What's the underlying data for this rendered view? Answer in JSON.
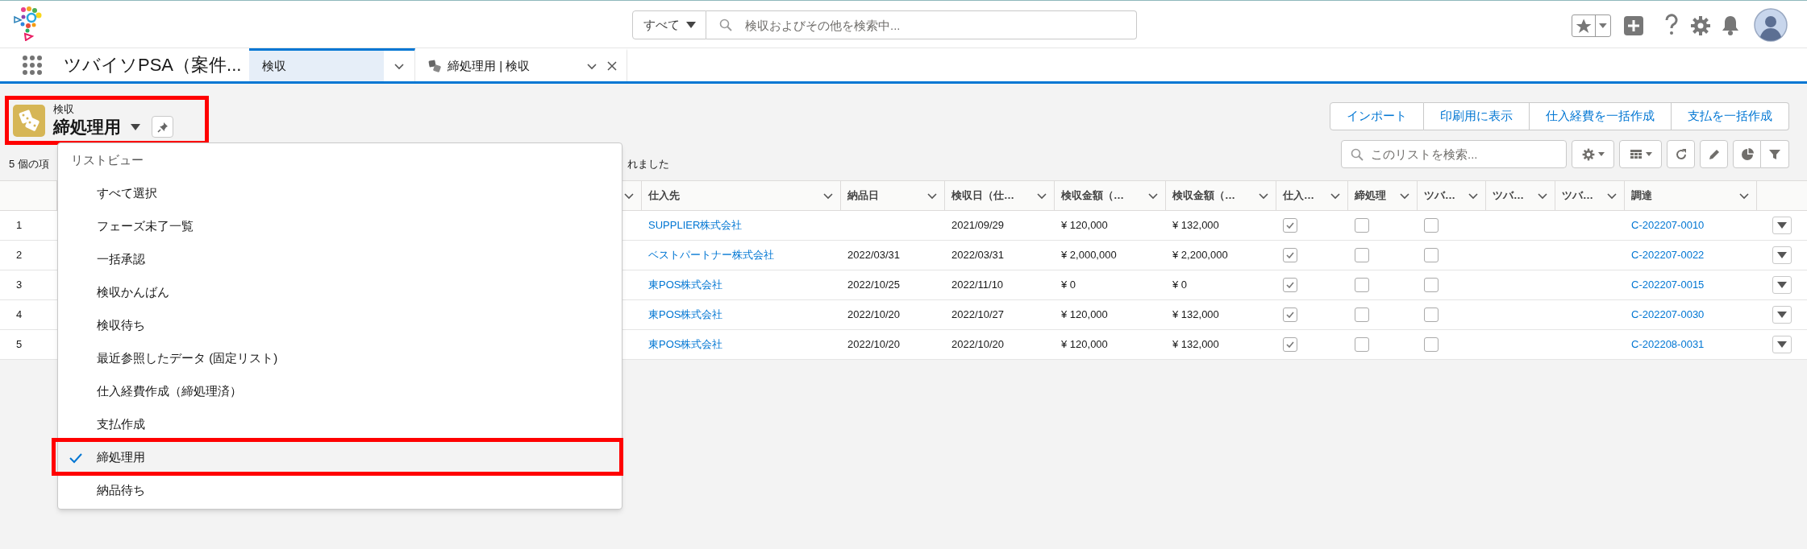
{
  "header": {
    "search_scope": "すべて",
    "search_placeholder": "検収およびその他を検索中..."
  },
  "nav": {
    "app_name": "ツバイソPSA（案件...",
    "tabs": [
      {
        "label": "検収",
        "selected": true,
        "kind": "object",
        "closable": false
      },
      {
        "label": "締処理用 | 検収",
        "selected": false,
        "kind": "list",
        "closable": true
      }
    ]
  },
  "list_header": {
    "object_label": "検収",
    "view_name": "締処理用",
    "status_left": "5 個の項",
    "status_right": "れました",
    "actions": [
      "インポート",
      "印刷用に表示",
      "仕入経費を一括作成",
      "支払を一括作成"
    ],
    "search_placeholder": "このリストを検索..."
  },
  "table": {
    "columns": [
      "仕入先",
      "納品日",
      "検収日（仕…",
      "検収金額（…",
      "検収金額（…",
      "仕入…",
      "締処理",
      "ツバ…",
      "ツバ…",
      "ツバ…",
      "調達"
    ],
    "rows": [
      {
        "number": "1",
        "supplier": "SUPPLIER株式会社",
        "inspection_date": "2021/09/29",
        "amount": "¥ 120,000",
        "amount_tax": "¥ 132,000",
        "purchase_checked": true,
        "closing_checked": false,
        "tsuba_checked": false,
        "procurement": "C-202207-0010"
      },
      {
        "number": "2",
        "supplier": "ベストパートナー株式会社",
        "delivery_date": "2022/03/31",
        "inspection_date": "2022/03/31",
        "amount": "¥ 2,000,000",
        "amount_tax": "¥ 2,200,000",
        "purchase_checked": true,
        "closing_checked": false,
        "tsuba_checked": false,
        "procurement": "C-202207-0022"
      },
      {
        "number": "3",
        "supplier": "東POS株式会社",
        "delivery_date": "2022/10/25",
        "inspection_date": "2022/11/10",
        "amount": "¥ 0",
        "amount_tax": "¥ 0",
        "purchase_checked": true,
        "closing_checked": false,
        "tsuba_checked": false,
        "procurement": "C-202207-0015"
      },
      {
        "number": "4",
        "supplier": "東POS株式会社",
        "delivery_date": "2022/10/20",
        "inspection_date": "2022/10/27",
        "amount": "¥ 120,000",
        "amount_tax": "¥ 132,000",
        "purchase_checked": true,
        "closing_checked": false,
        "tsuba_checked": false,
        "procurement": "C-202207-0030"
      },
      {
        "number": "5",
        "supplier": "東POS株式会社",
        "delivery_date": "2022/10/20",
        "inspection_date": "2022/10/20",
        "amount": "¥ 120,000",
        "amount_tax": "¥ 132,000",
        "purchase_checked": true,
        "closing_checked": false,
        "tsuba_checked": false,
        "procurement": "C-202208-0031"
      }
    ]
  },
  "list_view_menu": {
    "heading": "リストビュー",
    "items": [
      {
        "label": "すべて選択",
        "selected": false
      },
      {
        "label": "フェーズ未了一覧",
        "selected": false
      },
      {
        "label": "一括承認",
        "selected": false
      },
      {
        "label": "検収かんばん",
        "selected": false
      },
      {
        "label": "検収待ち",
        "selected": false
      },
      {
        "label": "最近参照したデータ (固定リスト)",
        "selected": false
      },
      {
        "label": "仕入経費作成（締処理済）",
        "selected": false
      },
      {
        "label": "支払作成",
        "selected": false
      },
      {
        "label": "締処理用",
        "selected": true
      },
      {
        "label": "納品待ち",
        "selected": false
      }
    ]
  }
}
